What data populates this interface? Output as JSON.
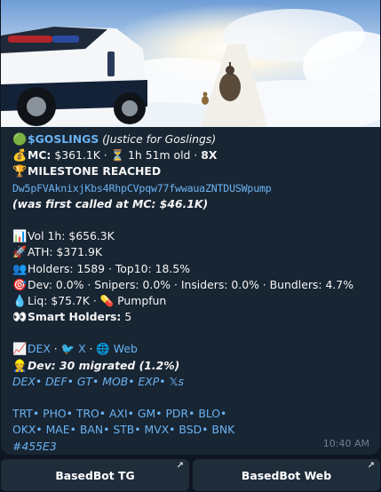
{
  "message": {
    "title_emoji": "🟢",
    "ticker": "$GOSLINGS",
    "project_name": "(Justice for Goslings)",
    "mc_emoji": "💰",
    "mc_label": "MC:",
    "mc_value": "$361.1K",
    "age_emoji": "⏳",
    "age": "1h 51m old",
    "multiplier": "8X",
    "milestone_emoji": "🏆",
    "milestone": "MILESTONE REACHED",
    "contract_address": "Dw5pFVAknixjKbs4RhpCVpqw77fwwauaZNTDUSWpump",
    "first_called": "(was first called at MC: $46.1K)",
    "stats": [
      {
        "emoji": "📊",
        "text": "Vol 1h: $656.3K"
      },
      {
        "emoji": "🚀",
        "text": "ATH: $371.9K"
      },
      {
        "emoji": "👥",
        "text": "Holders: 1589 · Top10: 18.5%"
      },
      {
        "emoji": "🎯",
        "text": "Dev: 0.0% · Snipers: 0.0% · Insiders: 0.0% · Bundlers: 4.7%"
      }
    ],
    "liq_emoji": "💧",
    "liq": "Liq: $75.7K ·",
    "pill_emoji": "💊",
    "platform": "Pumpfun",
    "smart_emoji": "👀",
    "smart_label": "Smart Holders:",
    "smart_value": "5",
    "links_emoji": "📈",
    "link_dex": "DEX",
    "x_emoji": "🐦",
    "link_x": "X",
    "web_emoji": "🌐",
    "link_web": "Web",
    "dev_emoji": "👷",
    "dev_migrated": "Dev: 30 migrated (1.2%)",
    "chart_links": "DEX• DEF• GT• MOB• EXP• 𝕏s",
    "trade_links_1": "TRT• PHO• TRO• AXI• GM• PDR• BLO•",
    "trade_links_2": "OKX• MAE• BAN• STB• MVX• BSD• BNK",
    "hashtag": "#455E3",
    "time": "10:40 AM"
  },
  "buttons": [
    {
      "label": "BasedBot TG",
      "icon": "arrow-up-right-icon"
    },
    {
      "label": "BasedBot Web",
      "icon": "arrow-up-right-icon"
    }
  ],
  "colors": {
    "background": "#0e1621",
    "bubble": "#182533",
    "link": "#6ab3f3",
    "button": "#1f2d3b",
    "timestamp": "#6d7f8f"
  }
}
